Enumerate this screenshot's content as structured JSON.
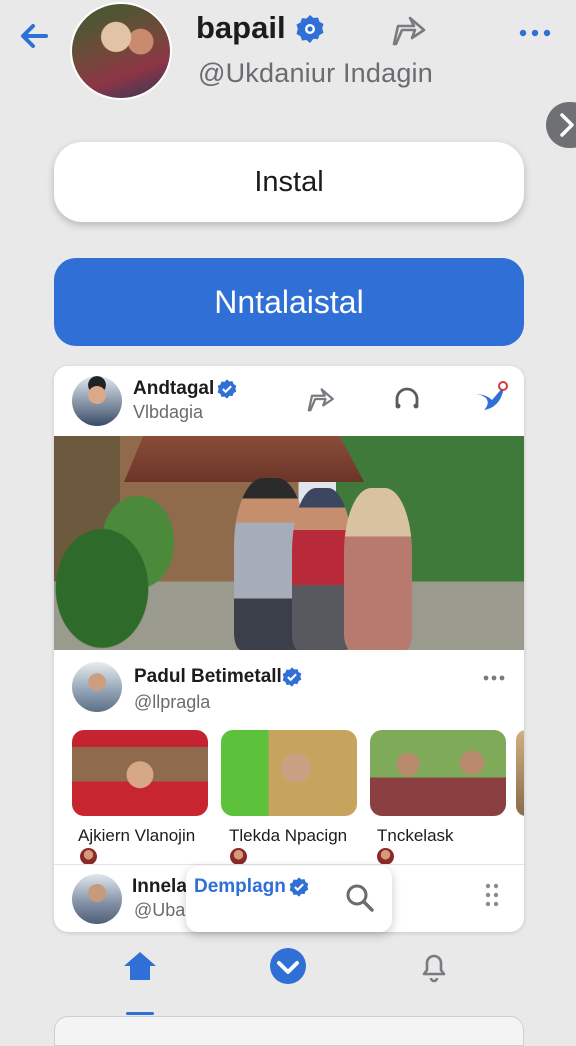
{
  "header": {
    "name": "bapail",
    "handle": "@Ukdaniur Indagin"
  },
  "buttons": {
    "install_label": "Instal",
    "primary_label": "Nntalaistal"
  },
  "post": {
    "author": "Andtagal",
    "handle": "Vlbdagia"
  },
  "recommended": {
    "name": "Padul Betimetall",
    "handle": "@llpragla",
    "items": [
      {
        "label": "Ajkiern Vlanojin"
      },
      {
        "label": "Tlekda Npacign"
      },
      {
        "label": "Tnckelask"
      }
    ]
  },
  "footer_account": {
    "name": "Innelai",
    "handle": "@Ubali"
  },
  "popup": {
    "name": "Demplagn"
  },
  "colors": {
    "accent": "#2f6fd6",
    "background": "#e9e9ea",
    "muted_text": "#6b6b70"
  },
  "icons": {
    "back": "arrow-left-icon",
    "verified": "verified-badge-icon",
    "share": "share-icon",
    "more": "more-horizontal-icon",
    "headphone": "headphone-icon",
    "bird": "bird-icon",
    "search": "search-icon",
    "grid": "drag-handle-icon",
    "home": "home-icon",
    "check": "check-circle-icon",
    "bell": "bell-icon",
    "chevron": "chevron-right-icon"
  }
}
